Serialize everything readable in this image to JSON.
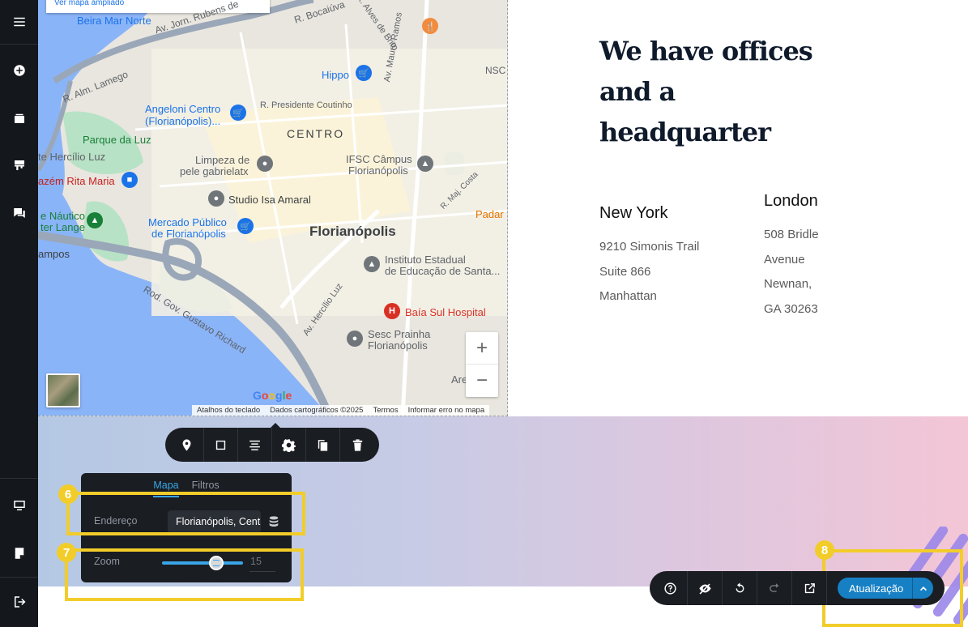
{
  "left_toolbar": {
    "items": [
      {
        "name": "menu-icon",
        "label": "menu"
      },
      {
        "name": "add-icon",
        "label": "add"
      },
      {
        "name": "layers-icon",
        "label": "sections"
      },
      {
        "name": "brush-icon",
        "label": "design"
      },
      {
        "name": "comments-icon",
        "label": "comments"
      },
      {
        "name": "desktop-icon",
        "label": "desktop"
      },
      {
        "name": "notes-icon",
        "label": "notes"
      },
      {
        "name": "exit-icon",
        "label": "exit"
      }
    ]
  },
  "map": {
    "ampliado_link": "Ver mapa ampliado",
    "labels": {
      "beira_mar": "Beira Mar Norte",
      "av_jorn": "Av. Jorn. Rubens de",
      "r_bocaiuva": "R. Bocaiúva",
      "r_alves": "R. Alves de Brito",
      "r_alm_lamego": "R. Alm. Lamego",
      "hippo": "Hippo",
      "nsc": "NSC",
      "angeloni_1": "Angeloni Centro",
      "angeloni_2": "(Florianópolis)...",
      "r_presidente": "R. Presidente Coutinho",
      "av_mauro": "Av. Mauro Ramos",
      "centro": "CENTRO",
      "parque": "Parque da Luz",
      "hercilio": "te Hercílio Luz",
      "limpeza_1": "Limpeza de",
      "limpeza_2": "pele gabrielatx",
      "ifsc_1": "IFSC Câmpus",
      "ifsc_2": "Florianópolis",
      "rita": "azém Rita Maria",
      "studio": "Studio Isa Amaral",
      "r_maj": "R. Maj. Costa",
      "padar": "Padar",
      "nautico_1": "e Náutico",
      "nautico_2": "ter Lange",
      "mercado_1": "Mercado Público",
      "mercado_2": "de Florianópolis",
      "florianopolis": "Florianópolis",
      "ampos": "ampos",
      "instituto_1": "Instituto Estadual",
      "instituto_2": "de Educação de Santa...",
      "rod_gov": "Rod. Gov. Gustavo Richard",
      "av_hercilio": "Av. Hercílio Luz",
      "baia_sul": "Baía Sul Hospital",
      "sesc_1": "Sesc Prainha",
      "sesc_2": "Florianópolis",
      "are": "Are"
    },
    "zoom_in": "+",
    "zoom_out": "−",
    "google": [
      "G",
      "o",
      "o",
      "g",
      "l",
      "e"
    ],
    "attribution": {
      "keyboard": "Atalhos do teclado",
      "data": "Dados cartográficos ©2025",
      "terms": "Termos",
      "report": "Informar erro no mapa"
    }
  },
  "content": {
    "headline_lines": [
      "We have offices",
      "and a",
      "headquarter"
    ],
    "offices": [
      {
        "city": "New York",
        "lines": [
          "9210 Simonis Trail",
          "Suite 866",
          "Manhattan"
        ]
      },
      {
        "city": "London",
        "lines": [
          "508 Bridle",
          "Avenue",
          "Newnan,",
          "GA 30263"
        ]
      }
    ]
  },
  "element_toolbar": {
    "buttons": [
      "pin-icon",
      "square-icon",
      "align-icon",
      "gear-icon",
      "copy-icon",
      "trash-icon"
    ]
  },
  "settings_panel": {
    "tabs": [
      {
        "label": "Mapa",
        "active": true
      },
      {
        "label": "Filtros",
        "active": false
      }
    ],
    "address_label": "Endereço",
    "address_value": "Florianópolis, Centro",
    "zoom_label": "Zoom",
    "zoom_value": "15",
    "zoom_fraction": 0.67
  },
  "annotations": {
    "badge_6": "6",
    "badge_7": "7",
    "badge_8": "8"
  },
  "action_bar": {
    "buttons": [
      "help-icon",
      "hide-icon",
      "undo-icon",
      "redo-icon",
      "external-link-icon"
    ],
    "update_label": "Atualização"
  },
  "colors": {
    "accent": "#3aa5e6",
    "update_button": "#1780c4",
    "highlight": "#f2cd2a",
    "toolbar_bg": "#1a1d22"
  }
}
